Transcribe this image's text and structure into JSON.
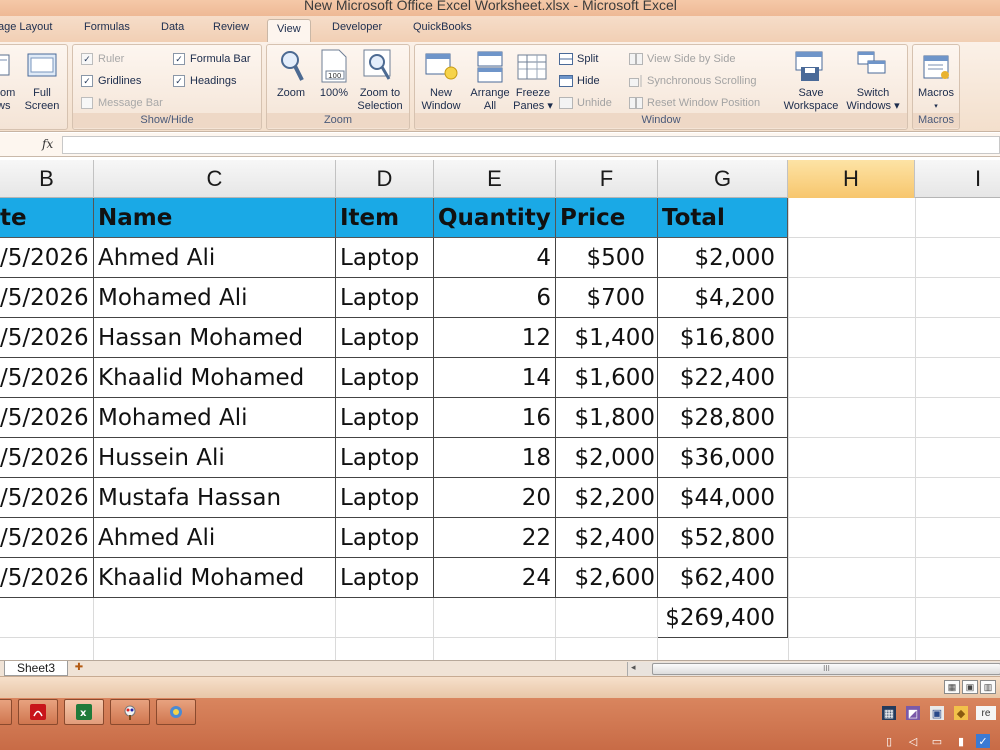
{
  "window": {
    "title": "New Microsoft Office Excel Worksheet.xlsx - Microsoft Excel"
  },
  "ribbon_tabs": [
    "age Layout",
    "Formulas",
    "Data",
    "Review",
    "View",
    "Developer",
    "QuickBooks"
  ],
  "active_tab": "View",
  "workbook_views": {
    "custom_views_label_1": "tom",
    "custom_views_label_2": "ws",
    "full_screen_label_1": "Full",
    "full_screen_label_2": "Screen"
  },
  "show_hide": {
    "label": "Show/Hide",
    "ruler": "Ruler",
    "formula_bar": "Formula Bar",
    "gridlines": "Gridlines",
    "headings": "Headings",
    "message_bar": "Message Bar"
  },
  "zoom_group": {
    "label": "Zoom",
    "zoom": "Zoom",
    "hundred": "100%",
    "hundred_icon_text": "100",
    "zoom_to_selection_1": "Zoom to",
    "zoom_to_selection_2": "Selection"
  },
  "window_group": {
    "label": "Window",
    "new_window_1": "New",
    "new_window_2": "Window",
    "arrange_all_1": "Arrange",
    "arrange_all_2": "All",
    "freeze_panes_1": "Freeze",
    "freeze_panes_2": "Panes ▾",
    "split": "Split",
    "hide": "Hide",
    "unhide": "Unhide",
    "view_side_by_side": "View Side by Side",
    "synchronous_scrolling": "Synchronous Scrolling",
    "reset_window_position": "Reset Window Position",
    "save_workspace_1": "Save",
    "save_workspace_2": "Workspace",
    "switch_windows_1": "Switch",
    "switch_windows_2": "Windows ▾"
  },
  "macros_group": {
    "label": "Macros",
    "macros": "Macros",
    "macros_arrow": "▾"
  },
  "formula_bar": {
    "fx": "fx",
    "value": ""
  },
  "columns": [
    "B",
    "C",
    "D",
    "E",
    "F",
    "G",
    "H",
    "I"
  ],
  "selected_column": "H",
  "table": {
    "headers": [
      "te",
      "Name",
      "Item",
      "Quantity",
      "Price",
      "Total"
    ],
    "rows": [
      [
        "/5/2026",
        "Ahmed Ali",
        "Laptop",
        "4",
        "$500",
        "$2,000"
      ],
      [
        "/5/2026",
        "Mohamed Ali",
        "Laptop",
        "6",
        "$700",
        "$4,200"
      ],
      [
        "/5/2026",
        "Hassan Mohamed",
        "Laptop",
        "12",
        "$1,400",
        "$16,800"
      ],
      [
        "/5/2026",
        "Khaalid Mohamed",
        "Laptop",
        "14",
        "$1,600",
        "$22,400"
      ],
      [
        "/5/2026",
        "Mohamed Ali",
        "Laptop",
        "16",
        "$1,800",
        "$28,800"
      ],
      [
        "/5/2026",
        "Hussein Ali",
        "Laptop",
        "18",
        "$2,000",
        "$36,000"
      ],
      [
        "/5/2026",
        "Mustafa Hassan",
        "Laptop",
        "20",
        "$2,200",
        "$44,000"
      ],
      [
        "/5/2026",
        "Ahmed Ali",
        "Laptop",
        "22",
        "$2,400",
        "$52,800"
      ],
      [
        "/5/2026",
        "Khaalid Mohamed",
        "Laptop",
        "24",
        "$2,600",
        "$62,400"
      ]
    ],
    "grand_total": "$269,400",
    "header_color": "#1aa9e6"
  },
  "sheet_tabs": [
    "Sheet3"
  ],
  "scroll_grip": "III",
  "colors": {
    "selected_column": "#f7c66d",
    "title_bar": "#eeb995",
    "taskbar": "#c86b46"
  }
}
